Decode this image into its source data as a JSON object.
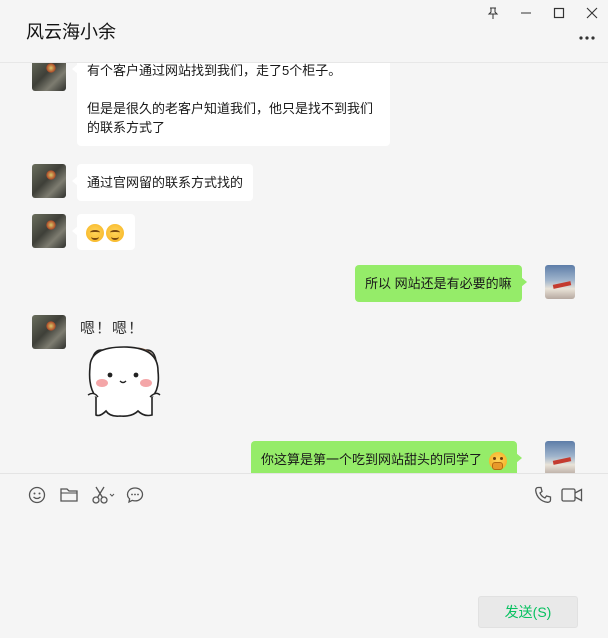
{
  "window": {
    "title": "风云海小余",
    "controls": [
      "pin-icon",
      "minimize-icon",
      "maximize-icon",
      "close-icon"
    ]
  },
  "messages": [
    {
      "side": "left",
      "paragraphs": [
        "有个客户通过网站找到我们，走了5个柜子。",
        "但是是很久的老客户知道我们，他只是找不到我们的联系方式了"
      ]
    },
    {
      "side": "left",
      "text": "通过官网留的联系方式找的"
    },
    {
      "side": "left",
      "emoji": [
        "smiling-face-emoji",
        "smiling-face-emoji"
      ]
    },
    {
      "side": "right",
      "text": "所以 网站还是有必要的嘛"
    },
    {
      "side": "left",
      "sticker": "cat-sticker",
      "sticker_text": "嗯！嗯！"
    },
    {
      "side": "right",
      "text": "你这算是第一个吃到网站甜头的同学了",
      "trailing_emoji": "thinking-face-emoji"
    }
  ],
  "toolbar": {
    "left_icons": [
      "emoji-icon",
      "folder-icon",
      "scissors-icon",
      "chat-bubble-icon"
    ],
    "right_icons": [
      "phone-icon",
      "video-call-icon"
    ]
  },
  "input": {
    "value": ""
  },
  "send_button": {
    "label": "发送(S)"
  },
  "colors": {
    "bubble_self": "#95ec69",
    "bubble_other": "#ffffff",
    "send_text": "#07c160",
    "background": "#f5f5f5"
  }
}
